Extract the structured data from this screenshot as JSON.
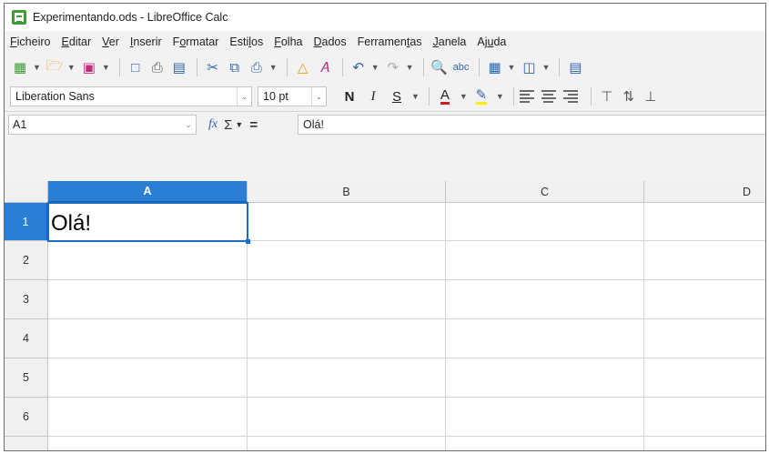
{
  "window": {
    "title": "Experimentando.ods - LibreOffice Calc"
  },
  "menu": [
    {
      "before": "",
      "acc": "F",
      "after": "icheiro"
    },
    {
      "before": "",
      "acc": "E",
      "after": "ditar"
    },
    {
      "before": "",
      "acc": "V",
      "after": "er"
    },
    {
      "before": "",
      "acc": "I",
      "after": "nserir"
    },
    {
      "before": "F",
      "acc": "o",
      "after": "rmatar"
    },
    {
      "before": "Esti",
      "acc": "l",
      "after": "os"
    },
    {
      "before": "",
      "acc": "F",
      "after": "olha"
    },
    {
      "before": "",
      "acc": "D",
      "after": "ados"
    },
    {
      "before": "Ferramen",
      "acc": "t",
      "after": "as"
    },
    {
      "before": "",
      "acc": "J",
      "after": "anela"
    },
    {
      "before": "Aj",
      "acc": "u",
      "after": "da"
    }
  ],
  "toolbar_standard": {
    "icons": [
      "new-spreadsheet-icon",
      "open-folder-icon",
      "save-icon",
      "export-pdf-icon",
      "print-icon",
      "print-preview-icon",
      "cut-icon",
      "copy-icon",
      "paste-icon",
      "clone-formatting-icon",
      "clear-formatting-icon",
      "undo-icon",
      "redo-icon",
      "find-replace-icon",
      "spelling-icon",
      "row-icon",
      "column-icon",
      "chart-icon"
    ]
  },
  "toolbar_format": {
    "font_name": "Liberation Sans",
    "font_size": "10 pt",
    "bold_label": "N",
    "italic_label": "I",
    "underline_label": "S",
    "font_color_label": "A",
    "font_color": "#c9211e",
    "highlight_color": "#ffee00"
  },
  "formula_bar": {
    "name_box": "A1",
    "fx_label": "fx",
    "sum_label": "Σ",
    "equals_label": "=",
    "content": "Olá!"
  },
  "sheet": {
    "columns": [
      "A",
      "B",
      "C",
      "D"
    ],
    "rows": [
      "1",
      "2",
      "3",
      "4",
      "5",
      "6"
    ],
    "active_cell": "A1",
    "cells": {
      "A1": "Olá!"
    },
    "accent_color": "#2a7fd4"
  }
}
